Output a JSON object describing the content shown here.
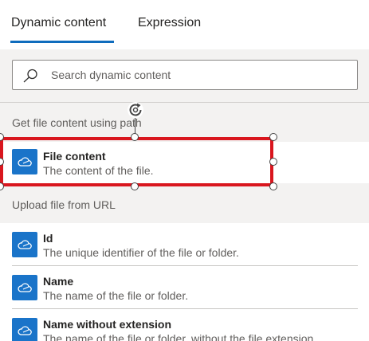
{
  "tabs": {
    "dynamic_content": "Dynamic content",
    "expression": "Expression"
  },
  "search": {
    "placeholder": "Search dynamic content",
    "icon": "search-icon"
  },
  "sections": [
    {
      "header": "Get file content using path",
      "items": [
        {
          "title": "File content",
          "description": "The content of the file.",
          "icon": "cloud-icon"
        }
      ]
    },
    {
      "header": "Upload file from URL",
      "items": [
        {
          "title": "Id",
          "description": "The unique identifier of the file or folder.",
          "icon": "cloud-icon"
        },
        {
          "title": "Name",
          "description": "The name of the file or folder.",
          "icon": "cloud-icon"
        },
        {
          "title": "Name without extension",
          "description": "The name of the file or folder, without the file extension.",
          "icon": "cloud-icon"
        }
      ]
    }
  ],
  "colors": {
    "accent": "#0f6cbd",
    "icon_background": "#1a74c9",
    "selection": "#d9161e",
    "panel_background": "#f3f2f1"
  }
}
